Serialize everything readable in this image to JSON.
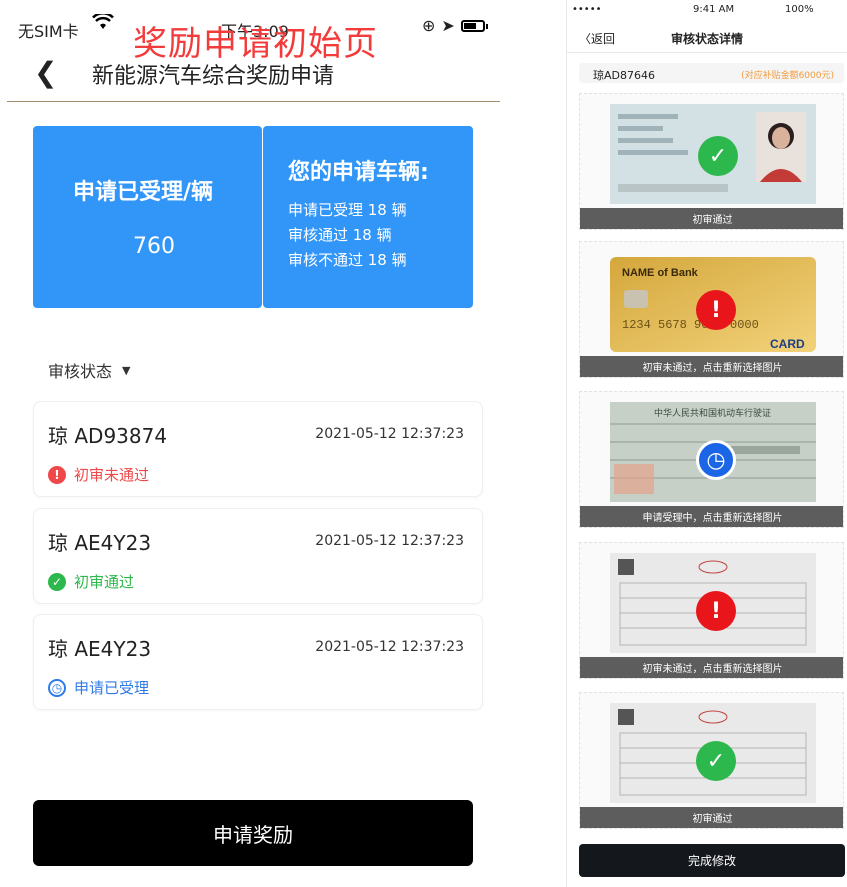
{
  "left": {
    "status_bar": {
      "carrier": "无SIM卡",
      "time": "下午3:09"
    },
    "overlay_title": "奖励申请初始页",
    "nav": {
      "title": "新能源汽车综合奖励申请"
    },
    "summary": {
      "accepted_label": "申请已受理/辆",
      "accepted_count": "760",
      "vehicles_title": "您的申请车辆:",
      "lines": [
        "申请已受理 18 辆",
        "审核通过 18 辆",
        "审核不通过 18 辆"
      ]
    },
    "filter_label": "审核状态",
    "records": [
      {
        "plate": "琼 AD93874",
        "datetime": "2021-05-12  12:37:23",
        "status": "初审未通过",
        "status_color": "#f04848"
      },
      {
        "plate": "琼 AE4Y23",
        "datetime": "2021-05-12  12:37:23",
        "status": "初审通过",
        "status_color": "#2db84d"
      },
      {
        "plate": "琼 AE4Y23",
        "datetime": "2021-05-12  12:37:23",
        "status": "申请已受理",
        "status_color": "#2f7be8"
      }
    ],
    "apply_button": "申请奖励"
  },
  "right": {
    "status_bar": {
      "signal": "•••••",
      "time": "9:41 AM",
      "battery": "100%"
    },
    "nav": {
      "back": "〈返回",
      "title": "审核状态详情"
    },
    "plate": "琼AD87646",
    "subsidy": "(对应补贴金额6000元)",
    "docs": [
      {
        "type": "id-card",
        "status": "初审通过",
        "state": "pass"
      },
      {
        "type": "bank-card",
        "status": "初审未通过，点击重新选择图片",
        "state": "fail",
        "card_bank": "NAME of Bank",
        "card_number": "1234 5678 9000 0000",
        "card_label": "CARD"
      },
      {
        "type": "vehicle-license",
        "status": "申请受理中，点击重新选择图片",
        "state": "pending",
        "license_title": "中华人民共和国机动车行驶证"
      },
      {
        "type": "invoice",
        "status": "初审未通过，点击重新选择图片",
        "state": "fail"
      },
      {
        "type": "invoice",
        "status": "初审通过",
        "state": "pass"
      }
    ],
    "done_button": "完成修改"
  },
  "colors": {
    "primary_blue": "#3196f8",
    "fail_red": "#e8161b",
    "pass_green": "#2db84d",
    "pending_blue": "#1b66e6"
  }
}
